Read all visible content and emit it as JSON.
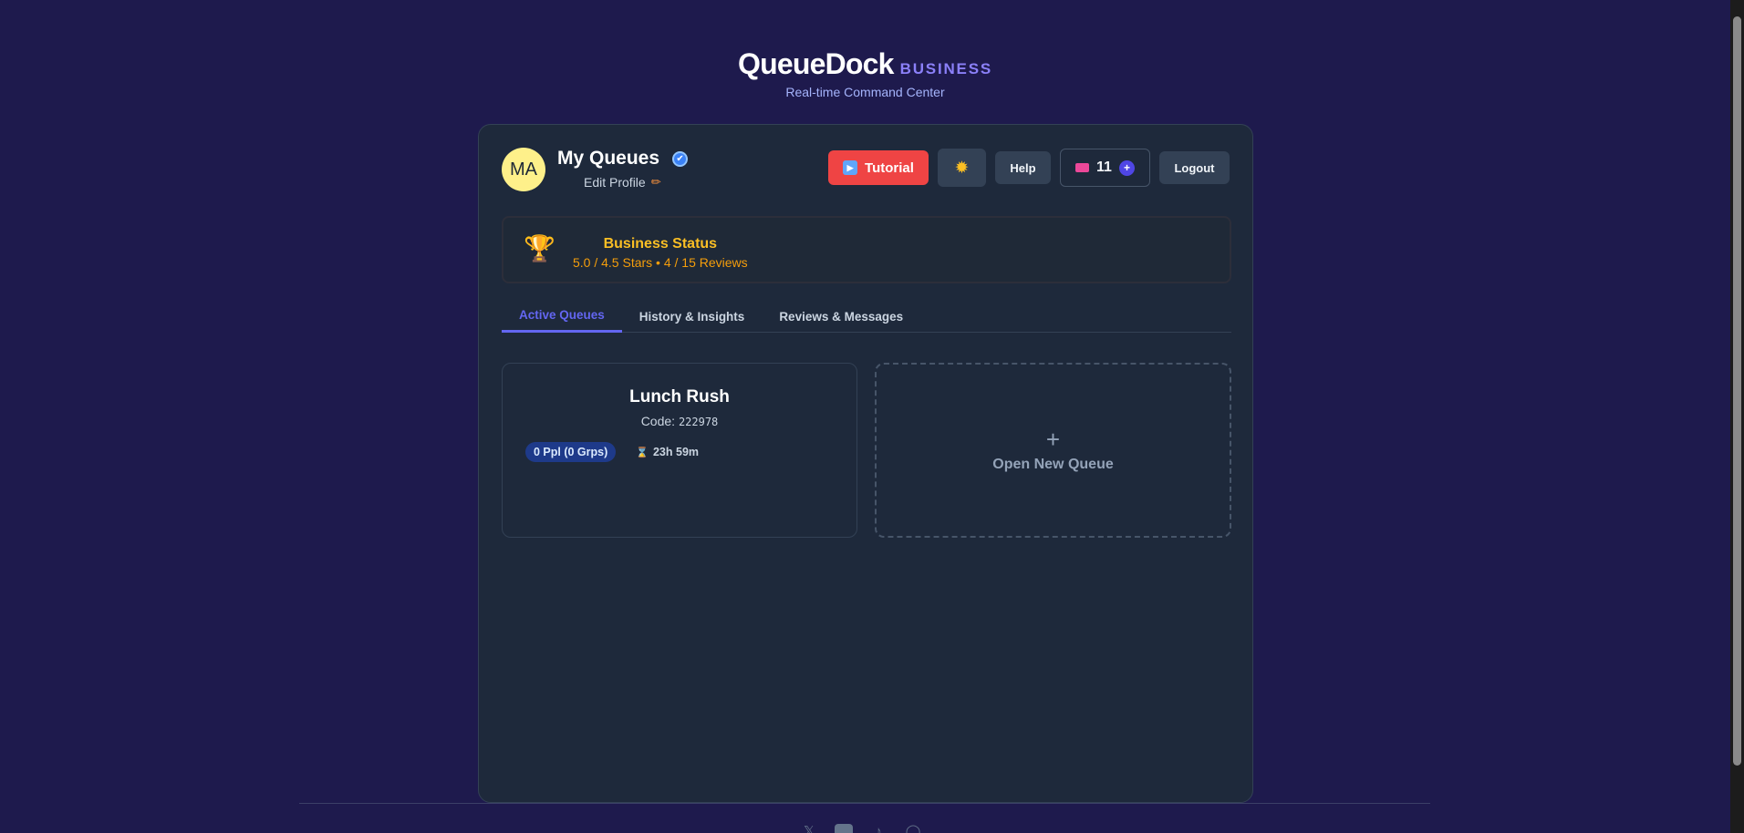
{
  "brand": {
    "name": "QueueDock",
    "tag": "BUSINESS",
    "subtitle": "Real-time Command Center"
  },
  "profile": {
    "initials": "MA",
    "title": "My Queues",
    "verified_icon": "✔",
    "edit_label": "Edit Profile",
    "edit_icon": "✏"
  },
  "toolbar": {
    "tutorial_label": "Tutorial",
    "tutorial_icon": "▶",
    "theme_icon": "✹",
    "help_label": "Help",
    "credits_count": "11",
    "credits_add_icon": "+",
    "logout_label": "Logout"
  },
  "status": {
    "icon": "🏆",
    "title": "Business Status",
    "summary": "5.0 / 4.5 Stars • 4 / 15 Reviews"
  },
  "tabs": [
    {
      "label": "Active Queues",
      "active": true
    },
    {
      "label": "History & Insights",
      "active": false
    },
    {
      "label": "Reviews & Messages",
      "active": false
    }
  ],
  "queues": [
    {
      "name": "Lunch Rush",
      "code_label": "Code:",
      "code": "222978",
      "people_badge": "0 Ppl (0 Grps)",
      "timer_icon": "⌛",
      "time_left": "23h 59m"
    }
  ],
  "new_queue": {
    "icon": "+",
    "label": "Open New Queue"
  },
  "footer": {
    "socials": [
      "x-icon",
      "youtube-icon",
      "tiktok-icon",
      "instagram-icon"
    ]
  },
  "colors": {
    "page_bg": "#1e1a4d",
    "card_bg": "#1e293b",
    "accent": "#6366f1",
    "tutorial": "#ef4444",
    "status_gold": "#fbbf24",
    "badge_bg": "#1e3a8a"
  }
}
